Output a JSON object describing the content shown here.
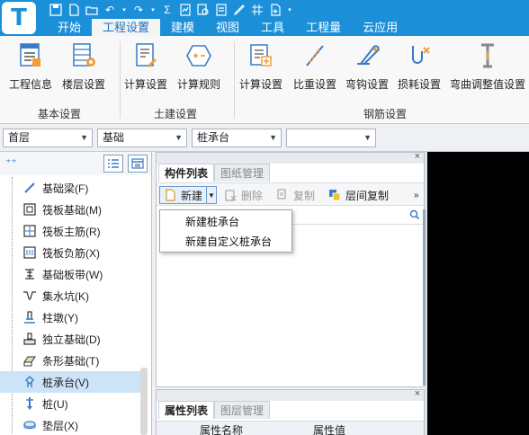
{
  "app": {
    "logo_letter": "T",
    "menu_tabs": [
      "开始",
      "工程设置",
      "建模",
      "视图",
      "工具",
      "工程量",
      "云应用"
    ],
    "active_menu": "工程设置"
  },
  "ribbon": {
    "groups": [
      {
        "label": "基本设置",
        "buttons": [
          "工程信息",
          "楼层设置"
        ]
      },
      {
        "label": "土建设置",
        "buttons": [
          "计算设置",
          "计算规则"
        ]
      },
      {
        "label": "钢筋设置",
        "buttons": [
          "计算设置",
          "比重设置",
          "弯钩设置",
          "损耗设置",
          "弯曲调整值设置"
        ]
      }
    ]
  },
  "filters": {
    "floor": "首层",
    "category": "基础",
    "type": "桩承台",
    "sub": ""
  },
  "nav": {
    "items": [
      {
        "label": "基础梁(F)",
        "icon": "beam-icon"
      },
      {
        "label": "筏板基础(M)",
        "icon": "raft-icon"
      },
      {
        "label": "筏板主筋(R)",
        "icon": "rebar-grid-icon"
      },
      {
        "label": "筏板负筋(X)",
        "icon": "neg-rebar-icon"
      },
      {
        "label": "基础板带(W)",
        "icon": "strip-icon"
      },
      {
        "label": "集水坑(K)",
        "icon": "pit-icon"
      },
      {
        "label": "柱墩(Y)",
        "icon": "pier-icon"
      },
      {
        "label": "独立基础(D)",
        "icon": "isolated-footing-icon"
      },
      {
        "label": "条形基础(T)",
        "icon": "strip-footing-icon"
      },
      {
        "label": "桩承台(V)",
        "icon": "pile-cap-icon",
        "selected": true
      },
      {
        "label": "桩(U)",
        "icon": "pile-icon"
      },
      {
        "label": "垫层(X)",
        "icon": "cushion-icon"
      }
    ]
  },
  "component_panel": {
    "tabs": [
      "构件列表",
      "图纸管理"
    ],
    "toolbar": {
      "new": "新建",
      "delete": "删除",
      "copy": "复制",
      "floor_copy": "层间复制",
      "more": "»"
    },
    "dropdown": [
      "新建桩承台",
      "新建自定义桩承台"
    ]
  },
  "property_panel": {
    "tabs": [
      "属性列表",
      "图层管理"
    ],
    "columns": [
      "属性名称",
      "属性值"
    ]
  }
}
